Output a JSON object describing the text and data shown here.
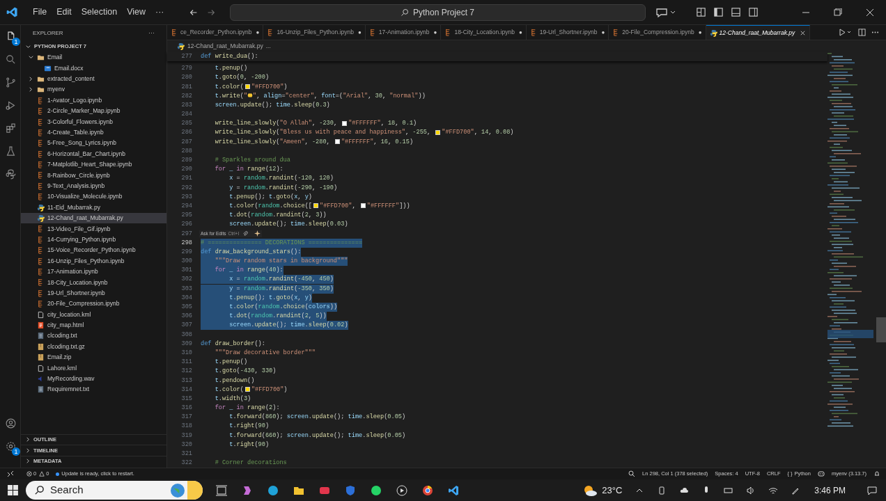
{
  "title_bar": {
    "menus": [
      "File",
      "Edit",
      "Selection",
      "View",
      "···"
    ],
    "search": "Python Project 7"
  },
  "activity_bar": {
    "explorer_badge": "1",
    "settings_badge": "1"
  },
  "sidebar": {
    "title": "EXPLORER",
    "more": "···",
    "project": "PYTHON PROJECT 7",
    "tree": [
      {
        "label": "Email",
        "kind": "folder",
        "expanded": true,
        "selected": false,
        "children": [
          {
            "label": "Email.docx",
            "kind": "word",
            "selected": false
          }
        ]
      },
      {
        "label": "extracted_content",
        "kind": "folder",
        "expanded": false,
        "selected": false
      },
      {
        "label": "myenv",
        "kind": "folder",
        "expanded": false,
        "selected": false
      },
      {
        "label": "1-Avator_Logo.ipynb",
        "kind": "notebook",
        "selected": false
      },
      {
        "label": "2-Circle_Marker_Map.ipynb",
        "kind": "notebook",
        "selected": false
      },
      {
        "label": "3-Colorful_Flowers.ipynb",
        "kind": "notebook",
        "selected": false
      },
      {
        "label": "4-Create_Table.ipynb",
        "kind": "notebook",
        "selected": false
      },
      {
        "label": "5-Free_Song_Lyrics.ipynb",
        "kind": "notebook",
        "selected": false
      },
      {
        "label": "6-Horizontal_Bar_Chart.ipynb",
        "kind": "notebook",
        "selected": false
      },
      {
        "label": "7-Matplotlib_Heart_Shape.ipynb",
        "kind": "notebook",
        "selected": false
      },
      {
        "label": "8-Rainbow_Circle.ipynb",
        "kind": "notebook",
        "selected": false
      },
      {
        "label": "9-Text_Analysis.ipynb",
        "kind": "notebook",
        "selected": false
      },
      {
        "label": "10-Visualize_Molecule.ipynb",
        "kind": "notebook",
        "selected": false
      },
      {
        "label": "11-Eid_Mubarrak.py",
        "kind": "python",
        "selected": false
      },
      {
        "label": "12-Chand_raat_Mubarrak.py",
        "kind": "python",
        "selected": true
      },
      {
        "label": "13-Video_File_Gif.ipynb",
        "kind": "notebook",
        "selected": false
      },
      {
        "label": "14-Currying_Python.ipynb",
        "kind": "notebook",
        "selected": false
      },
      {
        "label": "15-Voice_Recorder_Python.ipynb",
        "kind": "notebook",
        "selected": false
      },
      {
        "label": "16-Unzip_Files_Python.ipynb",
        "kind": "notebook",
        "selected": false
      },
      {
        "label": "17-Animation.ipynb",
        "kind": "notebook",
        "selected": false
      },
      {
        "label": "18-City_Location.ipynb",
        "kind": "notebook",
        "selected": false
      },
      {
        "label": "19-Url_Shortner.ipynb",
        "kind": "notebook",
        "selected": false
      },
      {
        "label": "20-File_Compression.ipynb",
        "kind": "notebook",
        "selected": false
      },
      {
        "label": "city_location.kml",
        "kind": "blank",
        "selected": false
      },
      {
        "label": "city_map.html",
        "kind": "html",
        "selected": false
      },
      {
        "label": "clcoding.txt",
        "kind": "text",
        "selected": false
      },
      {
        "label": "clcoding.txt.gz",
        "kind": "archive",
        "selected": false
      },
      {
        "label": "Email.zip",
        "kind": "archive",
        "selected": false
      },
      {
        "label": "Lahore.kml",
        "kind": "blank",
        "selected": false
      },
      {
        "label": "MyRecording.wav",
        "kind": "audio",
        "selected": false
      },
      {
        "label": "Requiremnet.txt",
        "kind": "text",
        "selected": false
      }
    ],
    "sections": [
      "OUTLINE",
      "TIMELINE",
      "METADATA"
    ]
  },
  "tabs": [
    {
      "label": "ce_Recorder_Python.ipynb",
      "kind": "notebook",
      "selected": false,
      "modified": true
    },
    {
      "label": "16-Unzip_Files_Python.ipynb",
      "kind": "notebook",
      "selected": false,
      "modified": true
    },
    {
      "label": "17-Animation.ipynb",
      "kind": "notebook",
      "selected": false,
      "modified": true
    },
    {
      "label": "18-City_Location.ipynb",
      "kind": "notebook",
      "selected": false,
      "modified": true
    },
    {
      "label": "19-Url_Shortner.ipynb",
      "kind": "notebook",
      "selected": false,
      "modified": true
    },
    {
      "label": "20-File_Compression.ipynb",
      "kind": "notebook",
      "selected": false,
      "modified": true
    },
    {
      "label": "12-Chand_raat_Mubarrak.py",
      "kind": "python",
      "selected": true,
      "modified": false
    }
  ],
  "tab_modified_mark": "●",
  "breadcrumb": [
    "12-Chand_raat_Mubarrak.py",
    "..."
  ],
  "editor": {
    "sticky_line": {
      "number": "277",
      "tokens": [
        {
          "kind": "kd",
          "text": "def "
        },
        {
          "kind": "f",
          "text": "write_dua"
        },
        {
          "kind": "p",
          "text": "():"
        }
      ]
    },
    "hint": {
      "label": "Ask for Edits",
      "shortcut": "Ctrl+I"
    },
    "lines": [
      {
        "number": "279",
        "current": false,
        "selected": false,
        "tokens": [
          {
            "kind": "v",
            "text": "    t"
          },
          {
            "kind": "p",
            "text": "."
          },
          {
            "kind": "f",
            "text": "penup"
          },
          {
            "kind": "p",
            "text": "()"
          }
        ]
      },
      {
        "number": "280",
        "current": false,
        "selected": false,
        "tokens": [
          {
            "kind": "v",
            "text": "    t"
          },
          {
            "kind": "p",
            "text": "."
          },
          {
            "kind": "f",
            "text": "goto"
          },
          {
            "kind": "p",
            "text": "("
          },
          {
            "kind": "n",
            "text": "0"
          },
          {
            "kind": "p",
            "text": ", "
          },
          {
            "kind": "n",
            "text": "-200"
          },
          {
            "kind": "p",
            "text": ")"
          }
        ]
      },
      {
        "number": "281",
        "current": false,
        "selected": false,
        "tokens": [
          {
            "kind": "v",
            "text": "    t"
          },
          {
            "kind": "p",
            "text": "."
          },
          {
            "kind": "f",
            "text": "color"
          },
          {
            "kind": "p",
            "text": "("
          },
          {
            "kind": "swatch",
            "color": "#ffd700"
          },
          {
            "kind": "s",
            "text": "\"#FFD700\""
          },
          {
            "kind": "p",
            "text": ")"
          }
        ]
      },
      {
        "number": "282",
        "current": false,
        "selected": false,
        "tokens": [
          {
            "kind": "v",
            "text": "    t"
          },
          {
            "kind": "p",
            "text": "."
          },
          {
            "kind": "f",
            "text": "write"
          },
          {
            "kind": "p",
            "text": "("
          },
          {
            "kind": "s",
            "text": "\""
          },
          {
            "kind": "emoji"
          },
          {
            "kind": "s",
            "text": "\""
          },
          {
            "kind": "p",
            "text": ", "
          },
          {
            "kind": "v",
            "text": "align"
          },
          {
            "kind": "p",
            "text": "="
          },
          {
            "kind": "s",
            "text": "\"center\""
          },
          {
            "kind": "p",
            "text": ", "
          },
          {
            "kind": "v",
            "text": "font"
          },
          {
            "kind": "p",
            "text": "=("
          },
          {
            "kind": "s",
            "text": "\"Arial\""
          },
          {
            "kind": "p",
            "text": ", "
          },
          {
            "kind": "n",
            "text": "30"
          },
          {
            "kind": "p",
            "text": ", "
          },
          {
            "kind": "s",
            "text": "\"normal\""
          },
          {
            "kind": "p",
            "text": "))"
          }
        ]
      },
      {
        "number": "283",
        "current": false,
        "selected": false,
        "tokens": [
          {
            "kind": "v",
            "text": "    screen"
          },
          {
            "kind": "p",
            "text": "."
          },
          {
            "kind": "f",
            "text": "update"
          },
          {
            "kind": "p",
            "text": "(); "
          },
          {
            "kind": "v",
            "text": "time"
          },
          {
            "kind": "p",
            "text": "."
          },
          {
            "kind": "f",
            "text": "sleep"
          },
          {
            "kind": "p",
            "text": "("
          },
          {
            "kind": "n",
            "text": "0.3"
          },
          {
            "kind": "p",
            "text": ")"
          }
        ]
      },
      {
        "number": "284",
        "current": false,
        "selected": false
      },
      {
        "number": "285",
        "current": false,
        "selected": false,
        "tokens": [
          {
            "kind": "f",
            "text": "    write_line_slowly"
          },
          {
            "kind": "p",
            "text": "("
          },
          {
            "kind": "s",
            "text": "\"O Allah\""
          },
          {
            "kind": "p",
            "text": ", "
          },
          {
            "kind": "n",
            "text": "-230"
          },
          {
            "kind": "p",
            "text": ", "
          },
          {
            "kind": "swatch",
            "color": "#ffffff"
          },
          {
            "kind": "s",
            "text": "\"#FFFFFF\""
          },
          {
            "kind": "p",
            "text": ", "
          },
          {
            "kind": "n",
            "text": "18"
          },
          {
            "kind": "p",
            "text": ", "
          },
          {
            "kind": "n",
            "text": "0.1"
          },
          {
            "kind": "p",
            "text": ")"
          }
        ]
      },
      {
        "number": "286",
        "current": false,
        "selected": false,
        "tokens": [
          {
            "kind": "f",
            "text": "    write_line_slowly"
          },
          {
            "kind": "p",
            "text": "("
          },
          {
            "kind": "s",
            "text": "\"Bless us with peace and happiness\""
          },
          {
            "kind": "p",
            "text": ", "
          },
          {
            "kind": "n",
            "text": "-255"
          },
          {
            "kind": "p",
            "text": ", "
          },
          {
            "kind": "swatch",
            "color": "#ffd700"
          },
          {
            "kind": "s",
            "text": "\"#FFD700\""
          },
          {
            "kind": "p",
            "text": ", "
          },
          {
            "kind": "n",
            "text": "14"
          },
          {
            "kind": "p",
            "text": ", "
          },
          {
            "kind": "n",
            "text": "0.08"
          },
          {
            "kind": "p",
            "text": ")"
          }
        ]
      },
      {
        "number": "287",
        "current": false,
        "selected": false,
        "tokens": [
          {
            "kind": "f",
            "text": "    write_line_slowly"
          },
          {
            "kind": "p",
            "text": "("
          },
          {
            "kind": "s",
            "text": "\"Ameen\""
          },
          {
            "kind": "p",
            "text": ", "
          },
          {
            "kind": "n",
            "text": "-280"
          },
          {
            "kind": "p",
            "text": ", "
          },
          {
            "kind": "swatch",
            "color": "#ffffff"
          },
          {
            "kind": "s",
            "text": "\"#FFFFFF\""
          },
          {
            "kind": "p",
            "text": ", "
          },
          {
            "kind": "n",
            "text": "16"
          },
          {
            "kind": "p",
            "text": ", "
          },
          {
            "kind": "n",
            "text": "0.15"
          },
          {
            "kind": "p",
            "text": ")"
          }
        ]
      },
      {
        "number": "288",
        "current": false,
        "selected": false
      },
      {
        "number": "289",
        "current": false,
        "selected": false,
        "tokens": [
          {
            "kind": "c",
            "text": "    # Sparkles around dua"
          }
        ]
      },
      {
        "number": "290",
        "current": false,
        "selected": false,
        "tokens": [
          {
            "kind": "kc",
            "text": "    for"
          },
          {
            "kind": "v",
            "text": " _ "
          },
          {
            "kind": "kc",
            "text": "in "
          },
          {
            "kind": "f",
            "text": "range"
          },
          {
            "kind": "p",
            "text": "("
          },
          {
            "kind": "n",
            "text": "12"
          },
          {
            "kind": "p",
            "text": "):"
          }
        ]
      },
      {
        "number": "291",
        "current": false,
        "selected": false,
        "tokens": [
          {
            "kind": "v",
            "text": "        x"
          },
          {
            "kind": "p",
            "text": " = "
          },
          {
            "kind": "b",
            "text": "random"
          },
          {
            "kind": "p",
            "text": "."
          },
          {
            "kind": "f",
            "text": "randint"
          },
          {
            "kind": "p",
            "text": "("
          },
          {
            "kind": "n",
            "text": "-120"
          },
          {
            "kind": "p",
            "text": ", "
          },
          {
            "kind": "n",
            "text": "120"
          },
          {
            "kind": "p",
            "text": ")"
          }
        ]
      },
      {
        "number": "292",
        "current": false,
        "selected": false,
        "tokens": [
          {
            "kind": "v",
            "text": "        y"
          },
          {
            "kind": "p",
            "text": " = "
          },
          {
            "kind": "b",
            "text": "random"
          },
          {
            "kind": "p",
            "text": "."
          },
          {
            "kind": "f",
            "text": "randint"
          },
          {
            "kind": "p",
            "text": "("
          },
          {
            "kind": "n",
            "text": "-290"
          },
          {
            "kind": "p",
            "text": ", "
          },
          {
            "kind": "n",
            "text": "-190"
          },
          {
            "kind": "p",
            "text": ")"
          }
        ]
      },
      {
        "number": "293",
        "current": false,
        "selected": false,
        "tokens": [
          {
            "kind": "v",
            "text": "        t"
          },
          {
            "kind": "p",
            "text": "."
          },
          {
            "kind": "f",
            "text": "penup"
          },
          {
            "kind": "p",
            "text": "(); "
          },
          {
            "kind": "v",
            "text": "t"
          },
          {
            "kind": "p",
            "text": "."
          },
          {
            "kind": "f",
            "text": "goto"
          },
          {
            "kind": "p",
            "text": "("
          },
          {
            "kind": "v",
            "text": "x"
          },
          {
            "kind": "p",
            "text": ", "
          },
          {
            "kind": "v",
            "text": "y"
          },
          {
            "kind": "p",
            "text": ")"
          }
        ]
      },
      {
        "number": "294",
        "current": false,
        "selected": false,
        "tokens": [
          {
            "kind": "v",
            "text": "        t"
          },
          {
            "kind": "p",
            "text": "."
          },
          {
            "kind": "f",
            "text": "color"
          },
          {
            "kind": "p",
            "text": "("
          },
          {
            "kind": "b",
            "text": "random"
          },
          {
            "kind": "p",
            "text": "."
          },
          {
            "kind": "f",
            "text": "choice"
          },
          {
            "kind": "p",
            "text": "(["
          },
          {
            "kind": "swatch",
            "color": "#ffd700"
          },
          {
            "kind": "s",
            "text": "\"#FFD700\""
          },
          {
            "kind": "p",
            "text": ", "
          },
          {
            "kind": "swatch",
            "color": "#ffffff"
          },
          {
            "kind": "s",
            "text": "\"#FFFFFF\""
          },
          {
            "kind": "p",
            "text": "]))"
          }
        ]
      },
      {
        "number": "295",
        "current": false,
        "selected": false,
        "tokens": [
          {
            "kind": "v",
            "text": "        t"
          },
          {
            "kind": "p",
            "text": "."
          },
          {
            "kind": "f",
            "text": "dot"
          },
          {
            "kind": "p",
            "text": "("
          },
          {
            "kind": "b",
            "text": "random"
          },
          {
            "kind": "p",
            "text": "."
          },
          {
            "kind": "f",
            "text": "randint"
          },
          {
            "kind": "p",
            "text": "("
          },
          {
            "kind": "n",
            "text": "2"
          },
          {
            "kind": "p",
            "text": ", "
          },
          {
            "kind": "n",
            "text": "3"
          },
          {
            "kind": "p",
            "text": "))"
          }
        ]
      },
      {
        "number": "296",
        "current": false,
        "selected": false,
        "tokens": [
          {
            "kind": "v",
            "text": "        screen"
          },
          {
            "kind": "p",
            "text": "."
          },
          {
            "kind": "f",
            "text": "update"
          },
          {
            "kind": "p",
            "text": "(); "
          },
          {
            "kind": "v",
            "text": "time"
          },
          {
            "kind": "p",
            "text": "."
          },
          {
            "kind": "f",
            "text": "sleep"
          },
          {
            "kind": "p",
            "text": "("
          },
          {
            "kind": "n",
            "text": "0.03"
          },
          {
            "kind": "p",
            "text": ")"
          }
        ]
      },
      {
        "number": "297",
        "current": false,
        "selected": false,
        "kind": "hint"
      },
      {
        "number": "298",
        "current": true,
        "selected": true,
        "tokens": [
          {
            "kind": "c",
            "text": "# =============== DECORATIONS ==============="
          }
        ]
      },
      {
        "number": "299",
        "current": false,
        "selected": true,
        "tokens": [
          {
            "kind": "kd",
            "text": "def "
          },
          {
            "kind": "f",
            "text": "draw_background_stars"
          },
          {
            "kind": "p",
            "text": "():"
          }
        ]
      },
      {
        "number": "300",
        "current": false,
        "selected": true,
        "tokens": [
          {
            "kind": "s",
            "text": "    \"\"\"Draw random stars in background\"\"\""
          }
        ]
      },
      {
        "number": "301",
        "current": false,
        "selected": true,
        "tokens": [
          {
            "kind": "kc",
            "text": "    for"
          },
          {
            "kind": "v",
            "text": " _ "
          },
          {
            "kind": "kc",
            "text": "in "
          },
          {
            "kind": "f",
            "text": "range"
          },
          {
            "kind": "p",
            "text": "("
          },
          {
            "kind": "n",
            "text": "40"
          },
          {
            "kind": "p",
            "text": "):"
          }
        ]
      },
      {
        "number": "302",
        "current": false,
        "selected": true,
        "tokens": [
          {
            "kind": "v",
            "text": "        x"
          },
          {
            "kind": "p",
            "text": " = "
          },
          {
            "kind": "b",
            "text": "random"
          },
          {
            "kind": "p",
            "text": "."
          },
          {
            "kind": "f",
            "text": "randint"
          },
          {
            "kind": "p",
            "text": "("
          },
          {
            "kind": "n",
            "text": "-450"
          },
          {
            "kind": "p",
            "text": ", "
          },
          {
            "kind": "n",
            "text": "450"
          },
          {
            "kind": "p",
            "text": ")"
          }
        ]
      },
      {
        "number": "303",
        "current": false,
        "selected": true,
        "tokens": [
          {
            "kind": "v",
            "text": "        y"
          },
          {
            "kind": "p",
            "text": " = "
          },
          {
            "kind": "b",
            "text": "random"
          },
          {
            "kind": "p",
            "text": "."
          },
          {
            "kind": "f",
            "text": "randint"
          },
          {
            "kind": "p",
            "text": "("
          },
          {
            "kind": "n",
            "text": "-350"
          },
          {
            "kind": "p",
            "text": ", "
          },
          {
            "kind": "n",
            "text": "350"
          },
          {
            "kind": "p",
            "text": ")"
          }
        ]
      },
      {
        "number": "304",
        "current": false,
        "selected": true,
        "tokens": [
          {
            "kind": "v",
            "text": "        t"
          },
          {
            "kind": "p",
            "text": "."
          },
          {
            "kind": "f",
            "text": "penup"
          },
          {
            "kind": "p",
            "text": "(); "
          },
          {
            "kind": "v",
            "text": "t"
          },
          {
            "kind": "p",
            "text": "."
          },
          {
            "kind": "f",
            "text": "goto"
          },
          {
            "kind": "p",
            "text": "("
          },
          {
            "kind": "v",
            "text": "x"
          },
          {
            "kind": "p",
            "text": ", "
          },
          {
            "kind": "v",
            "text": "y"
          },
          {
            "kind": "p",
            "text": ")"
          }
        ]
      },
      {
        "number": "305",
        "current": false,
        "selected": true,
        "tokens": [
          {
            "kind": "v",
            "text": "        t"
          },
          {
            "kind": "p",
            "text": "."
          },
          {
            "kind": "f",
            "text": "color"
          },
          {
            "kind": "p",
            "text": "("
          },
          {
            "kind": "b",
            "text": "random"
          },
          {
            "kind": "p",
            "text": "."
          },
          {
            "kind": "f",
            "text": "choice"
          },
          {
            "kind": "p",
            "text": "("
          },
          {
            "kind": "v",
            "text": "colors"
          },
          {
            "kind": "p",
            "text": "))"
          }
        ]
      },
      {
        "number": "306",
        "current": false,
        "selected": true,
        "tokens": [
          {
            "kind": "v",
            "text": "        t"
          },
          {
            "kind": "p",
            "text": "."
          },
          {
            "kind": "f",
            "text": "dot"
          },
          {
            "kind": "p",
            "text": "("
          },
          {
            "kind": "b",
            "text": "random"
          },
          {
            "kind": "p",
            "text": "."
          },
          {
            "kind": "f",
            "text": "randint"
          },
          {
            "kind": "p",
            "text": "("
          },
          {
            "kind": "n",
            "text": "2"
          },
          {
            "kind": "p",
            "text": ", "
          },
          {
            "kind": "n",
            "text": "5"
          },
          {
            "kind": "p",
            "text": "))"
          }
        ]
      },
      {
        "number": "307",
        "current": false,
        "selected": true,
        "tokens": [
          {
            "kind": "v",
            "text": "        screen"
          },
          {
            "kind": "p",
            "text": "."
          },
          {
            "kind": "f",
            "text": "update"
          },
          {
            "kind": "p",
            "text": "(); "
          },
          {
            "kind": "v",
            "text": "time"
          },
          {
            "kind": "p",
            "text": "."
          },
          {
            "kind": "f",
            "text": "sleep"
          },
          {
            "kind": "p",
            "text": "("
          },
          {
            "kind": "n",
            "text": "0.02"
          },
          {
            "kind": "p",
            "text": ")"
          }
        ]
      },
      {
        "number": "308",
        "current": false,
        "selected": false
      },
      {
        "number": "309",
        "current": false,
        "selected": false,
        "tokens": [
          {
            "kind": "kd",
            "text": "def "
          },
          {
            "kind": "f",
            "text": "draw_border"
          },
          {
            "kind": "p",
            "text": "():"
          }
        ]
      },
      {
        "number": "310",
        "current": false,
        "selected": false,
        "tokens": [
          {
            "kind": "s",
            "text": "    \"\"\"Draw decorative border\"\"\""
          }
        ]
      },
      {
        "number": "311",
        "current": false,
        "selected": false,
        "tokens": [
          {
            "kind": "v",
            "text": "    t"
          },
          {
            "kind": "p",
            "text": "."
          },
          {
            "kind": "f",
            "text": "penup"
          },
          {
            "kind": "p",
            "text": "()"
          }
        ]
      },
      {
        "number": "312",
        "current": false,
        "selected": false,
        "tokens": [
          {
            "kind": "v",
            "text": "    t"
          },
          {
            "kind": "p",
            "text": "."
          },
          {
            "kind": "f",
            "text": "goto"
          },
          {
            "kind": "p",
            "text": "("
          },
          {
            "kind": "n",
            "text": "-430"
          },
          {
            "kind": "p",
            "text": ", "
          },
          {
            "kind": "n",
            "text": "330"
          },
          {
            "kind": "p",
            "text": ")"
          }
        ]
      },
      {
        "number": "313",
        "current": false,
        "selected": false,
        "tokens": [
          {
            "kind": "v",
            "text": "    t"
          },
          {
            "kind": "p",
            "text": "."
          },
          {
            "kind": "f",
            "text": "pendown"
          },
          {
            "kind": "p",
            "text": "()"
          }
        ]
      },
      {
        "number": "314",
        "current": false,
        "selected": false,
        "tokens": [
          {
            "kind": "v",
            "text": "    t"
          },
          {
            "kind": "p",
            "text": "."
          },
          {
            "kind": "f",
            "text": "color"
          },
          {
            "kind": "p",
            "text": "("
          },
          {
            "kind": "swatch",
            "color": "#ffd700"
          },
          {
            "kind": "s",
            "text": "\"#FFD700\""
          },
          {
            "kind": "p",
            "text": ")"
          }
        ]
      },
      {
        "number": "315",
        "current": false,
        "selected": false,
        "tokens": [
          {
            "kind": "v",
            "text": "    t"
          },
          {
            "kind": "p",
            "text": "."
          },
          {
            "kind": "f",
            "text": "width"
          },
          {
            "kind": "p",
            "text": "("
          },
          {
            "kind": "n",
            "text": "3"
          },
          {
            "kind": "p",
            "text": ")"
          }
        ]
      },
      {
        "number": "316",
        "current": false,
        "selected": false,
        "tokens": [
          {
            "kind": "kc",
            "text": "    for"
          },
          {
            "kind": "v",
            "text": " _ "
          },
          {
            "kind": "kc",
            "text": "in "
          },
          {
            "kind": "f",
            "text": "range"
          },
          {
            "kind": "p",
            "text": "("
          },
          {
            "kind": "n",
            "text": "2"
          },
          {
            "kind": "p",
            "text": "):"
          }
        ]
      },
      {
        "number": "317",
        "current": false,
        "selected": false,
        "tokens": [
          {
            "kind": "v",
            "text": "        t"
          },
          {
            "kind": "p",
            "text": "."
          },
          {
            "kind": "f",
            "text": "forward"
          },
          {
            "kind": "p",
            "text": "("
          },
          {
            "kind": "n",
            "text": "860"
          },
          {
            "kind": "p",
            "text": "); "
          },
          {
            "kind": "v",
            "text": "screen"
          },
          {
            "kind": "p",
            "text": "."
          },
          {
            "kind": "f",
            "text": "update"
          },
          {
            "kind": "p",
            "text": "(); "
          },
          {
            "kind": "v",
            "text": "time"
          },
          {
            "kind": "p",
            "text": "."
          },
          {
            "kind": "f",
            "text": "sleep"
          },
          {
            "kind": "p",
            "text": "("
          },
          {
            "kind": "n",
            "text": "0.05"
          },
          {
            "kind": "p",
            "text": ")"
          }
        ]
      },
      {
        "number": "318",
        "current": false,
        "selected": false,
        "tokens": [
          {
            "kind": "v",
            "text": "        t"
          },
          {
            "kind": "p",
            "text": "."
          },
          {
            "kind": "f",
            "text": "right"
          },
          {
            "kind": "p",
            "text": "("
          },
          {
            "kind": "n",
            "text": "90"
          },
          {
            "kind": "p",
            "text": ")"
          }
        ]
      },
      {
        "number": "319",
        "current": false,
        "selected": false,
        "tokens": [
          {
            "kind": "v",
            "text": "        t"
          },
          {
            "kind": "p",
            "text": "."
          },
          {
            "kind": "f",
            "text": "forward"
          },
          {
            "kind": "p",
            "text": "("
          },
          {
            "kind": "n",
            "text": "660"
          },
          {
            "kind": "p",
            "text": "); "
          },
          {
            "kind": "v",
            "text": "screen"
          },
          {
            "kind": "p",
            "text": "."
          },
          {
            "kind": "f",
            "text": "update"
          },
          {
            "kind": "p",
            "text": "(); "
          },
          {
            "kind": "v",
            "text": "time"
          },
          {
            "kind": "p",
            "text": "."
          },
          {
            "kind": "f",
            "text": "sleep"
          },
          {
            "kind": "p",
            "text": "("
          },
          {
            "kind": "n",
            "text": "0.05"
          },
          {
            "kind": "p",
            "text": ")"
          }
        ]
      },
      {
        "number": "320",
        "current": false,
        "selected": false,
        "tokens": [
          {
            "kind": "v",
            "text": "        t"
          },
          {
            "kind": "p",
            "text": "."
          },
          {
            "kind": "f",
            "text": "right"
          },
          {
            "kind": "p",
            "text": "("
          },
          {
            "kind": "n",
            "text": "90"
          },
          {
            "kind": "p",
            "text": ")"
          }
        ]
      },
      {
        "number": "321",
        "current": false,
        "selected": false
      },
      {
        "number": "322",
        "current": false,
        "selected": false,
        "tokens": [
          {
            "kind": "c",
            "text": "    # Corner decorations"
          }
        ]
      }
    ]
  },
  "status_bar": {
    "errors": "0",
    "warnings": "0",
    "update": "Update is ready, click to restart.",
    "position": "Ln 298, Col 1 (378 selected)",
    "spaces": "Spaces: 4",
    "encoding": "UTF-8",
    "eol": "CRLF",
    "language": "Python",
    "braces": "{ }",
    "env": "myenv (3.13.7)"
  },
  "taskbar": {
    "search": "Search",
    "weather": "23°C",
    "time": "3:46 PM"
  }
}
